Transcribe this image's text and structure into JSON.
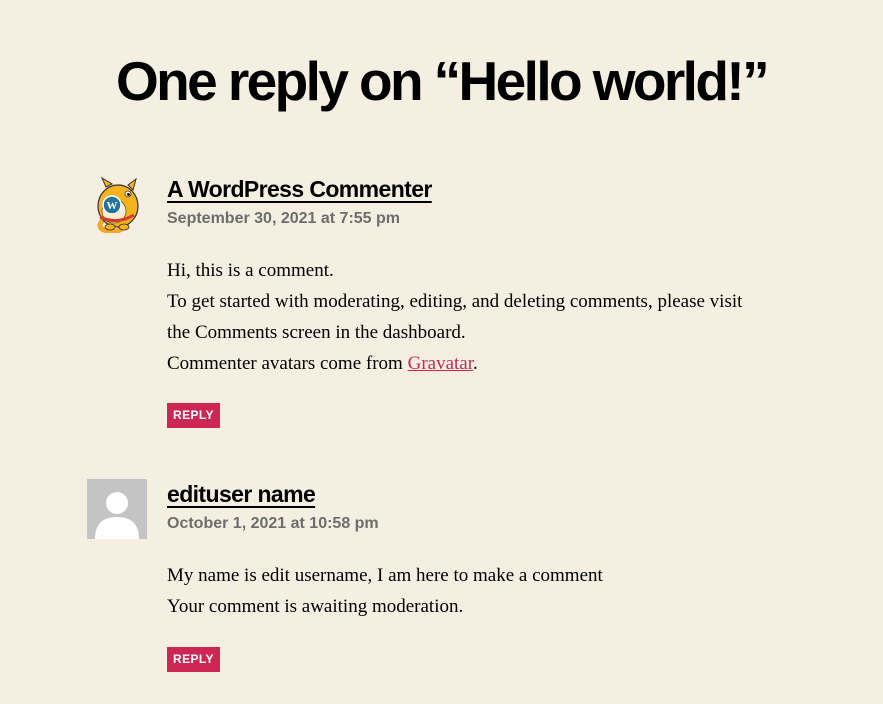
{
  "heading": "One reply on “Hello world!”",
  "colors": {
    "background": "#f4efe1",
    "accent": "#cd2653",
    "meta_gray": "#6d6d6d"
  },
  "comments": [
    {
      "author": "A WordPress Commenter",
      "date": "September 30, 2021 at 7:55 pm",
      "avatar_icon": "wapuu-wordpress-mascot-icon",
      "lines": [
        "Hi, this is a comment.",
        "To get started with moderating, editing, and deleting comments, please visit the Comments screen in the dashboard."
      ],
      "last_line_prefix": "Commenter avatars come from ",
      "link_text": "Gravatar",
      "last_line_suffix": ".",
      "reply_label": "REPLY"
    },
    {
      "author": "edituser name",
      "date": "October 1, 2021 at 10:58 pm",
      "avatar_icon": "default-user-avatar-icon",
      "lines": [
        "My name is edit username, I am here to make a comment",
        "Your comment is awaiting moderation."
      ],
      "reply_label": "REPLY"
    }
  ]
}
